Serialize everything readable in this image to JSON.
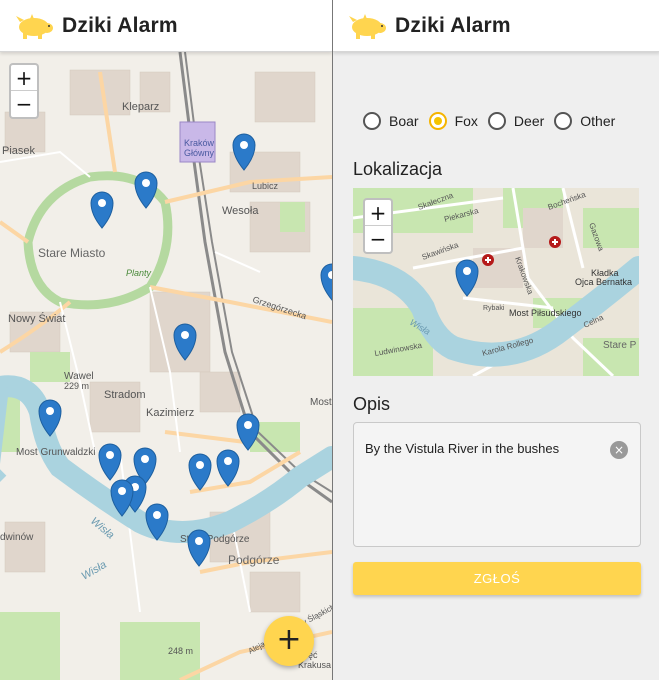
{
  "app": {
    "title": "Dziki Alarm"
  },
  "map": {
    "zoom_in": "+",
    "zoom_out": "−",
    "labels": {
      "kleparz": "Kleparz",
      "piasek": "Piasek",
      "krakow_glowny_1": "Kraków",
      "krakow_glowny_2": "Główny",
      "lubicz": "Lubicz",
      "wesola": "Wesoła",
      "stare_miasto": "Stare Miasto",
      "planty": "Planty",
      "nowy_swiat": "Nowy Świat",
      "grzegorzecka": "Grzegórzecka",
      "wawel": "Wawel",
      "wawel_elev": "229 m",
      "stradom": "Stradom",
      "kazimierz": "Kazimierz",
      "most_grunwaldzki": "Most Grunwaldzki",
      "most": "Most",
      "wisla": "Wisła",
      "wisla2": "Wisła",
      "stare_podgorze": "Stare Podgórze",
      "podgorze": "Podgórze",
      "dwinow": "dwinów",
      "slaskich": "Aleja Powstańców Śląskich",
      "elev_248": "248 m",
      "piec": "Pięć",
      "krakusa": "Krakusa"
    },
    "fab": "+"
  },
  "form": {
    "options": [
      {
        "label": "Boar",
        "selected": false
      },
      {
        "label": "Fox",
        "selected": true
      },
      {
        "label": "Deer",
        "selected": false
      },
      {
        "label": "Other",
        "selected": false
      }
    ],
    "location_label": "Lokalizacja",
    "minimap": {
      "zoom_in": "+",
      "zoom_out": "−",
      "labels": {
        "skaleczna": "Skałeczna",
        "piekarska": "Piekarska",
        "skawinska": "Skawińska",
        "bochenska": "Bocheńska",
        "gazowa": "Gazowa",
        "krakowska": "Krakowska",
        "wisla": "Wisła",
        "rybaki": "Rybaki",
        "most_pilsudskiego": "Most Piłsudskiego",
        "kladka_1": "Kładka",
        "kladka_2": "Ojca Bernatka",
        "ludwinowska": "Ludwinowska",
        "karola_rollego": "Karola Rollego",
        "celna": "Celna",
        "stare_p": "Stare P"
      }
    },
    "description_label": "Opis",
    "description_value": "By the Vistula River in the bushes",
    "clear_icon": "×",
    "submit_label": "ZGŁOŚ"
  },
  "colors": {
    "accent": "#ffd54f",
    "marker": "#2b7ac9",
    "river": "#aad3df"
  }
}
